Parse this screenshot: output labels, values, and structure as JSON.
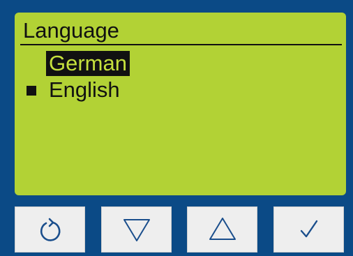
{
  "screen": {
    "title": "Language",
    "items": [
      {
        "label": "German",
        "highlighted": true,
        "selected": false
      },
      {
        "label": "English",
        "highlighted": false,
        "selected": true
      }
    ]
  },
  "buttons": [
    {
      "icon": "rotate-back-icon",
      "action": "back"
    },
    {
      "icon": "triangle-down-icon",
      "action": "down"
    },
    {
      "icon": "triangle-up-icon",
      "action": "up"
    },
    {
      "icon": "checkmark-icon",
      "action": "confirm"
    }
  ],
  "colors": {
    "frame": "#0b4a86",
    "lcd_background": "#b2d235",
    "text": "#111111",
    "button_face": "#eeeeee",
    "icon": "#1a4e8c"
  }
}
